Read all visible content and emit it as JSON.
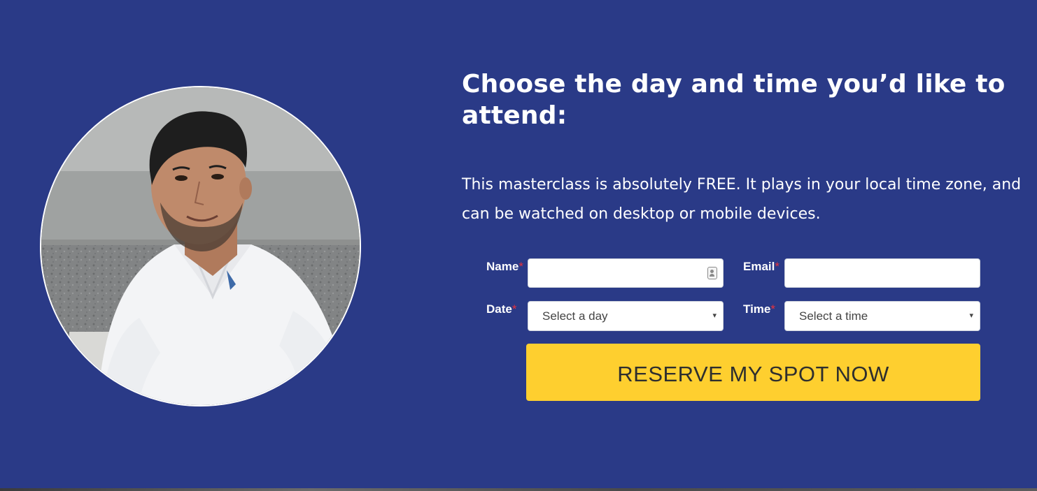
{
  "headline": "Choose the day and time you’d like to attend:",
  "description": "This masterclass is absolutely FREE. It plays in your local time zone, and can be watched on desktop or mobile devices.",
  "form": {
    "required_marker": "*",
    "name": {
      "label": "Name",
      "value": "",
      "placeholder": ""
    },
    "email": {
      "label": "Email",
      "value": "",
      "placeholder": ""
    },
    "date": {
      "label": "Date",
      "selected": "Select a day"
    },
    "time": {
      "label": "Time",
      "selected": "Select a time"
    },
    "submit_label": "RESERVE MY SPOT NOW"
  },
  "icons": {
    "name_field_icon": "contact-card-icon",
    "select_arrow": "▾"
  },
  "colors": {
    "background": "#2a3a87",
    "button": "#fecf2f",
    "button_text": "#2e2e2e",
    "required": "#e8323c",
    "text": "#ffffff"
  }
}
